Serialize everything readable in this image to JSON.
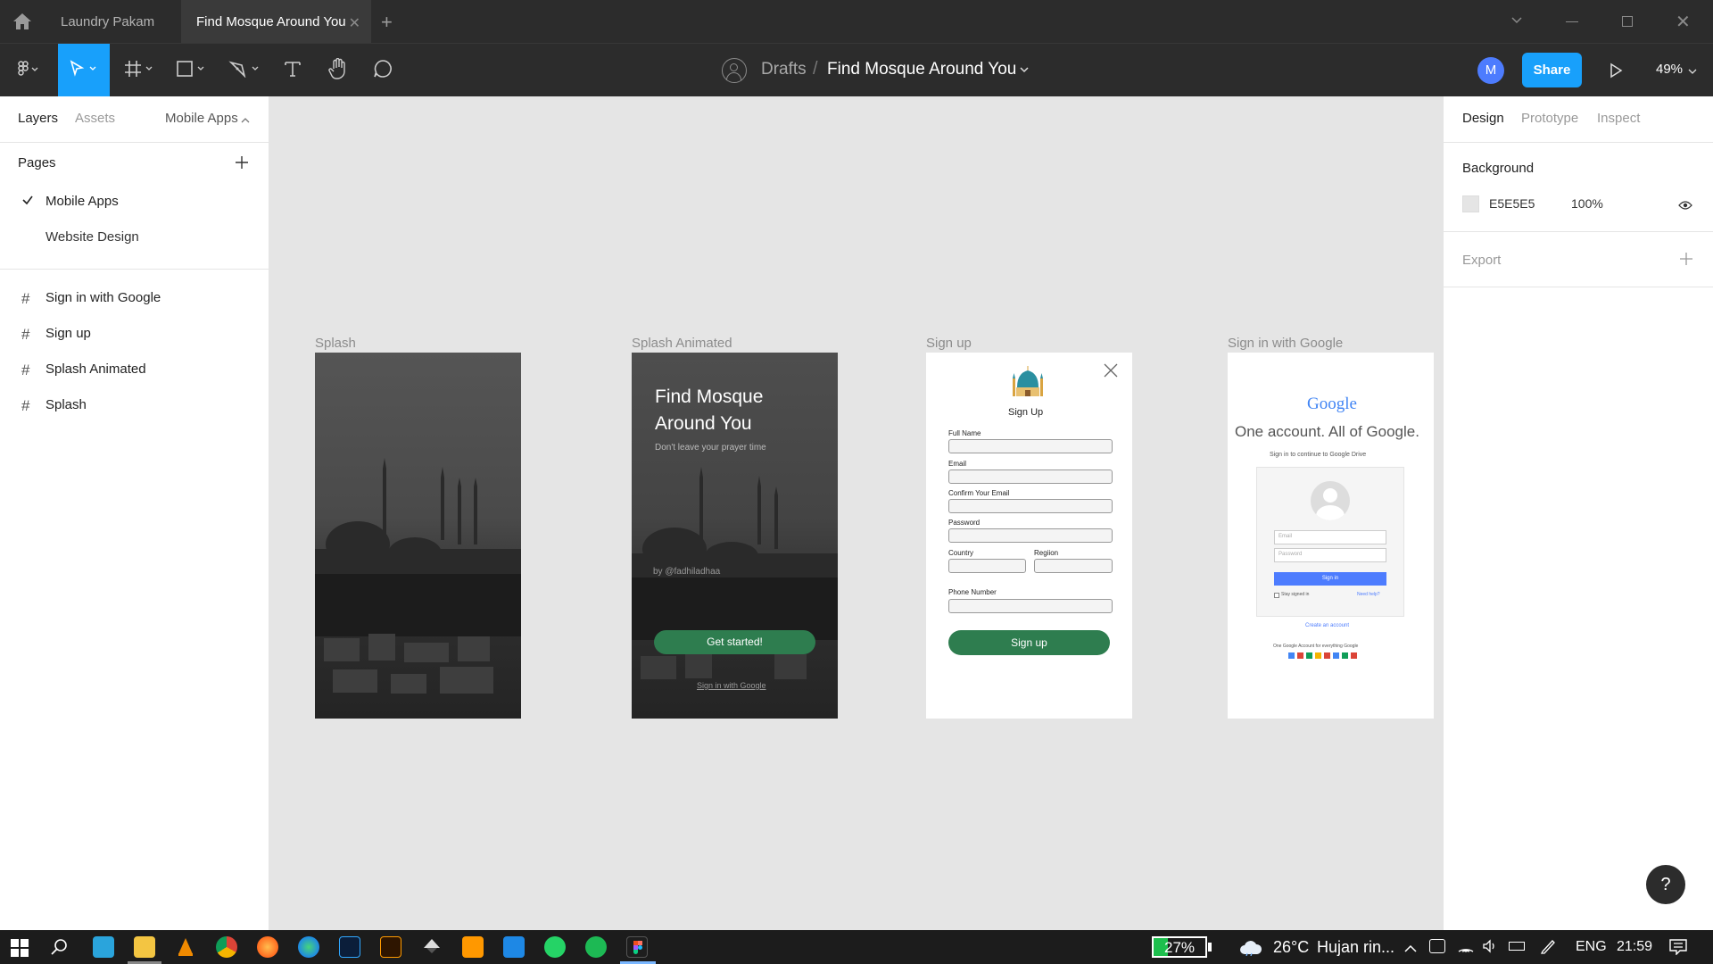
{
  "tabs": [
    {
      "label": "Laundry Pakam"
    },
    {
      "label": "Find Mosque Around You"
    }
  ],
  "toolbar": {
    "breadcrumb_root": "Drafts",
    "file_name": "Find Mosque Around You",
    "avatar": "M",
    "share": "Share",
    "zoom": "49%"
  },
  "left": {
    "tab_layers": "Layers",
    "tab_assets": "Assets",
    "page_dropdown": "Mobile Apps",
    "pages_title": "Pages",
    "pages": [
      "Mobile Apps",
      "Website Design"
    ],
    "layers": [
      "Sign in with Google",
      "Sign up",
      "Splash Animated",
      "Splash"
    ]
  },
  "right": {
    "tab_design": "Design",
    "tab_prototype": "Prototype",
    "tab_inspect": "Inspect",
    "background_title": "Background",
    "bg_hex": "E5E5E5",
    "bg_opacity": "100%",
    "export_title": "Export"
  },
  "frames": {
    "splash": {
      "label": "Splash"
    },
    "splash_animated": {
      "label": "Splash Animated",
      "title_line1": "Find Mosque",
      "title_line2": "Around You",
      "subtitle": "Don't leave your prayer time",
      "author": "by @fadhiladhaa",
      "cta": "Get started!",
      "link": "Sign in with Google"
    },
    "signup": {
      "label": "Sign up",
      "heading": "Sign Up",
      "full_name": "Full Name",
      "email": "Email",
      "confirm_email": "Confirm Your Email",
      "password": "Password",
      "country": "Country",
      "region": "Regiion",
      "phone": "Phone Number",
      "button": "Sign up"
    },
    "google": {
      "label": "Sign in with Google",
      "logo": "Google",
      "headline": "One account. All of Google.",
      "sub": "Sign in to continue to Google Drive",
      "email_ph": "Email",
      "password_ph": "Password",
      "signin": "Sign in",
      "stay": "Stay signed in",
      "help": "Need help?",
      "create": "Create an account",
      "footer": "One Google Account for everything Google"
    }
  },
  "taskbar": {
    "battery": "27%",
    "temp": "26°C",
    "weather": "Hujan rin...",
    "lang": "ENG",
    "time": "21:59"
  },
  "colors": {
    "accent": "#18a0fb",
    "green": "#2e7d4f",
    "dark": "#2c2c2c",
    "canvas": "#e5e5e5"
  },
  "help_icon": "?"
}
